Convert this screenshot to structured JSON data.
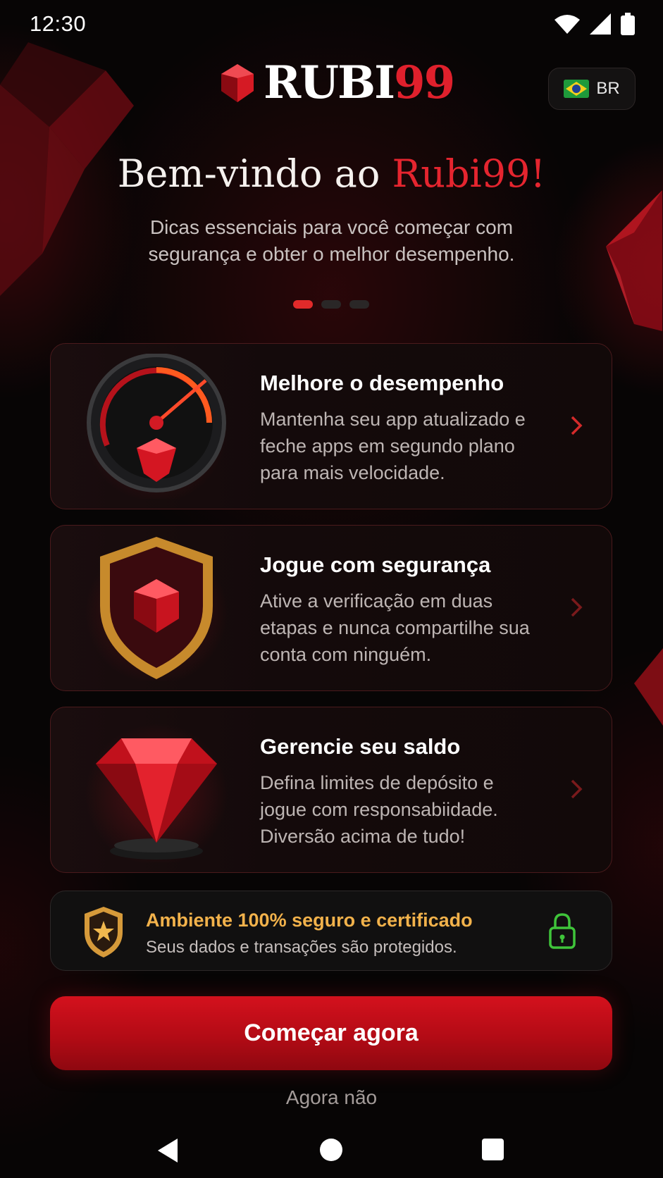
{
  "status_bar": {
    "time": "12:30"
  },
  "header": {
    "logo_main": "RUBI",
    "logo_accent": "99",
    "language_label": "BR"
  },
  "welcome": {
    "title_prefix": "Bem-vindo ao ",
    "title_accent": "Rubi99!",
    "subtitle": "Dicas essenciais para você começar com segurança e obter o melhor desempenho.",
    "pagination": {
      "total": 3,
      "active": 1
    }
  },
  "cards": [
    {
      "title": "Melhore o desempenho",
      "description": "Mantenha seu app atualizado e feche apps em segundo plano para mais velocidade.",
      "icon": "speedometer-ruby-icon"
    },
    {
      "title": "Jogue com segurança",
      "description": "Ative a verificação em duas etapas e nunca compartilhe sua conta com ninguém.",
      "icon": "shield-ruby-icon"
    },
    {
      "title": "Gerencie seu saldo",
      "description": "Defina limites de depósito e jogue com responsabiidade. Diversão acima de tudo!",
      "icon": "ruby-gem-icon"
    }
  ],
  "security_banner": {
    "title": "Ambiente 100% seguro e certificado",
    "subtitle": "Seus dados e transações são protegidos."
  },
  "actions": {
    "primary": "Começar agora",
    "secondary": "Agora não"
  },
  "colors": {
    "accent": "#e0202c",
    "gold": "#f2b24b",
    "lock_green": "#3fc43a",
    "background": "#070505"
  }
}
